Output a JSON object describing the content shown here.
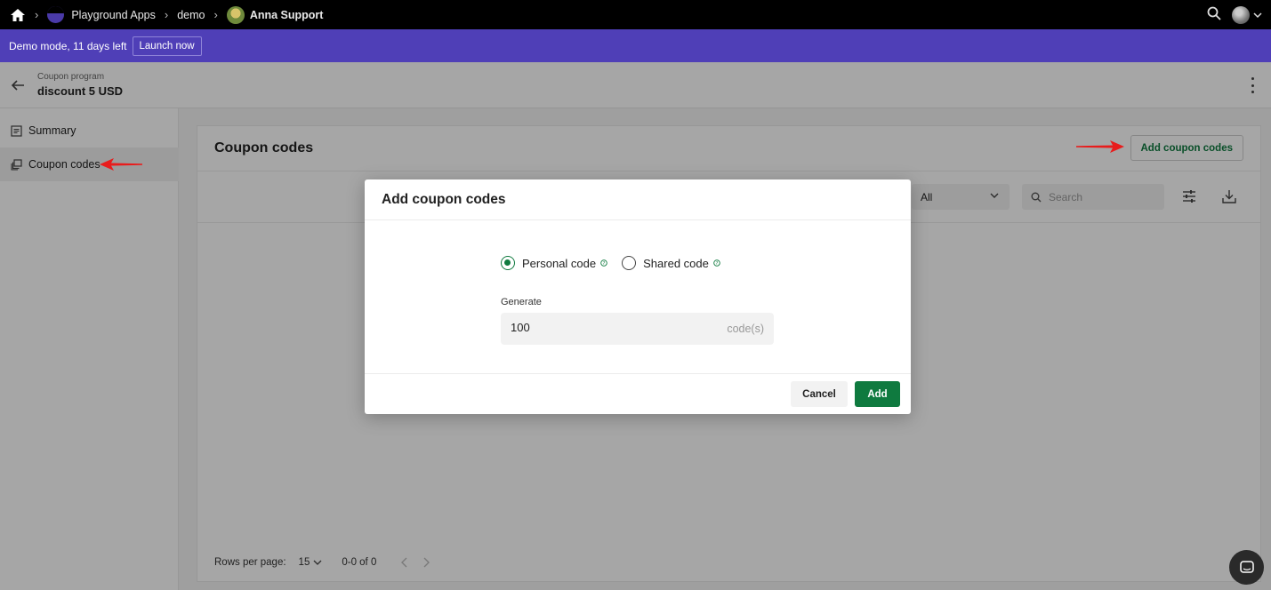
{
  "topbar": {
    "breadcrumbs": [
      "Playground Apps",
      "demo",
      "Anna Support"
    ],
    "icons": [
      "home-icon",
      "chevron-right-icon",
      "search-icon",
      "avatar",
      "chevron-down-icon"
    ]
  },
  "demo": {
    "text": "Demo mode, 11 days left",
    "launch_label": "Launch now"
  },
  "program": {
    "subtitle": "Coupon program",
    "title": "discount 5 USD"
  },
  "sidebar": {
    "items": [
      {
        "label": "Summary",
        "icon": "summary-icon"
      },
      {
        "label": "Coupon codes",
        "icon": "coupon-codes-icon"
      }
    ]
  },
  "main": {
    "title": "Coupon codes",
    "add_button_label": "Add coupon codes",
    "filter_value": "All",
    "search_placeholder": "Search",
    "pager": {
      "rows_per_page_label": "Rows per page:",
      "rows_per_page_value": "15",
      "range": "0-0 of 0"
    }
  },
  "modal": {
    "title": "Add coupon codes",
    "options": [
      {
        "label": "Personal code",
        "checked": true
      },
      {
        "label": "Shared code",
        "checked": false
      }
    ],
    "generate_label": "Generate",
    "generate_value": "100",
    "generate_suffix": "code(s)",
    "cancel_label": "Cancel",
    "add_label": "Add"
  },
  "colors": {
    "accent_green": "#0f7a3f",
    "demo_bar": "#4f3fb7",
    "annotation_red": "#e81c1c"
  }
}
